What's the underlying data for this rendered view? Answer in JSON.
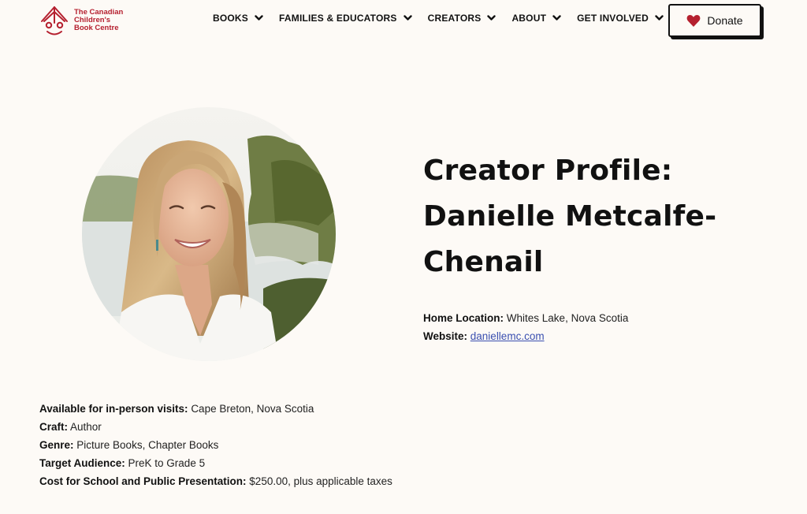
{
  "header": {
    "logo": {
      "line1": "The Canadian",
      "line2": "Children's",
      "line3": "Book Centre",
      "icon": "book-child-logo-icon",
      "color": "#b5202f"
    },
    "nav": [
      {
        "label": "BOOKS",
        "icon": "chevron-down-icon"
      },
      {
        "label": "FAMILIES & EDUCATORS",
        "icon": "chevron-down-icon"
      },
      {
        "label": "CREATORS",
        "icon": "chevron-down-icon"
      },
      {
        "label": "ABOUT",
        "icon": "chevron-down-icon"
      },
      {
        "label": "GET INVOLVED",
        "icon": "chevron-down-icon"
      }
    ],
    "donate": {
      "label": "Donate",
      "icon": "heart-icon",
      "icon_color": "#b5202f"
    }
  },
  "profile": {
    "title_line1": "Creator Profile:",
    "title_line2": "Danielle Metcalfe-",
    "title_line3": "Chenail",
    "home_location_label": "Home Location:",
    "home_location_value": "Whites Lake, Nova Scotia",
    "website_label": "Website:",
    "website_value": "daniellemc.com",
    "link_color": "#3a4fb0"
  },
  "details": {
    "visits_label": "Available for in-person visits:",
    "visits_value": "Cape Breton, Nova Scotia",
    "craft_label": "Craft:",
    "craft_value": "Author",
    "genre_label": "Genre:",
    "genre_value": "Picture Books, Chapter Books",
    "audience_label": "Target Audience:",
    "audience_value": "PreK to Grade 5",
    "cost_label": "Cost for School and Public Presentation:",
    "cost_value": "$250.00, plus applicable taxes"
  },
  "colors": {
    "background": "#fdfaf6",
    "brand_red": "#b5202f",
    "text": "#111111"
  }
}
